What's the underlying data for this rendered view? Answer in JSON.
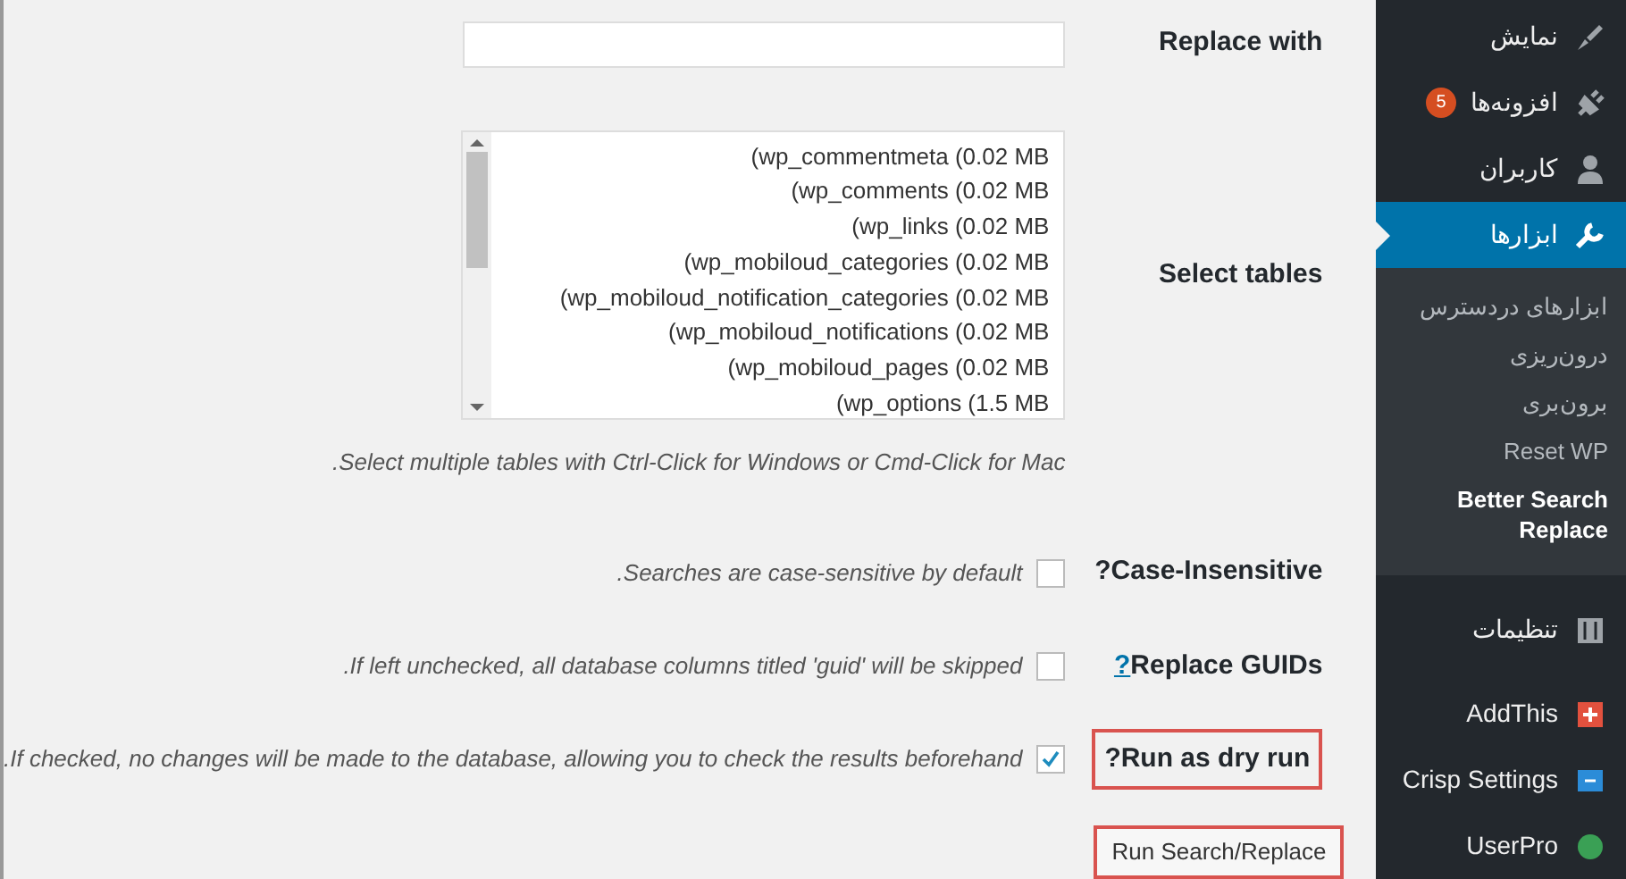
{
  "form": {
    "replace_with": {
      "label": "Replace with"
    },
    "select_tables": {
      "label": "Select tables",
      "options": [
        {
          "text": "(wp_commentmeta (0.02 MB",
          "selected": false
        },
        {
          "text": "(wp_comments (0.02 MB",
          "selected": false
        },
        {
          "text": "(wp_links (0.02 MB",
          "selected": false
        },
        {
          "text": "(wp_mobiloud_categories (0.02 MB",
          "selected": false
        },
        {
          "text": "(wp_mobiloud_notification_categories (0.02 MB",
          "selected": false
        },
        {
          "text": "(wp_mobiloud_notifications (0.02 MB",
          "selected": false
        },
        {
          "text": "(wp_mobiloud_pages (0.02 MB",
          "selected": false
        },
        {
          "text": "(wp_options (1.5 MB",
          "selected": false
        }
      ],
      "hint": ".Select multiple tables with Ctrl-Click for Windows or Cmd-Click for Mac"
    },
    "options": [
      {
        "label": "?Case-Insensitive",
        "description": ".Searches are case-sensitive by default",
        "checked": false,
        "highlighted": false
      },
      {
        "label": "Replace GUIDs",
        "help_link": "?",
        "description": ".If left unchecked, all database columns titled 'guid' will be skipped",
        "checked": false,
        "highlighted": false
      },
      {
        "label": "?Run as dry run",
        "description": ".If checked, no changes will be made to the database, allowing you to check the results beforehand",
        "checked": true,
        "highlighted": true
      }
    ],
    "submit": {
      "label": "Run Search/Replace",
      "highlighted": true
    }
  },
  "sidebar": {
    "items": [
      {
        "label": "نمایش",
        "selected": false
      },
      {
        "label": "افزونه‌ها",
        "badge": "5",
        "selected": false
      },
      {
        "label": "کاربران",
        "selected": false
      },
      {
        "label": "ابزارها",
        "selected": true,
        "children": [
          {
            "label": "ابزارهای دردسترس",
            "selected": false
          },
          {
            "label": "درون‌ریزی",
            "selected": false
          },
          {
            "label": "برون‌بری",
            "selected": false
          },
          {
            "label": "Reset WP",
            "selected": false
          },
          {
            "label": "Better Search Replace",
            "selected": true
          }
        ]
      },
      {
        "label": "تنظیمات",
        "selected": false
      },
      {
        "label": "AddThis",
        "selected": false
      },
      {
        "label": "Crisp Settings",
        "selected": false
      },
      {
        "label": "UserPro",
        "selected": false
      }
    ]
  }
}
